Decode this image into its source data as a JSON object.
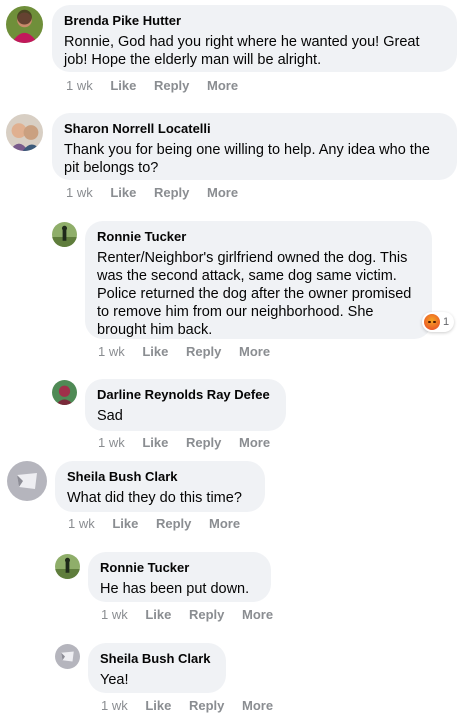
{
  "colors": {
    "bubble": "#f0f2f5",
    "name": "#050505",
    "meta": "#8a8d91"
  },
  "comments": [
    {
      "author": "Brenda Pike Hutter",
      "text": "Ronnie, God had you right where he wanted you! Great job! Hope the elderly man will be alright.",
      "time": "1 wk",
      "like": "Like",
      "reply": "Reply",
      "more": "More",
      "avatar_icon": "profile-photo"
    },
    {
      "author": "Sharon Norrell Locatelli",
      "text": "Thank you for being one willing to help. Any idea who the pit belongs to?",
      "time": "1 wk",
      "like": "Like",
      "reply": "Reply",
      "more": "More",
      "avatar_icon": "profile-photo"
    },
    {
      "author": "Ronnie Tucker",
      "text": "Renter/Neighbor's girlfriend owned the dog. This was the second attack, same dog same victim. Police returned the dog after the owner promised to remove him from our neighborhood. She brought him back.",
      "time": "1 wk",
      "like": "Like",
      "reply": "Reply",
      "more": "More",
      "avatar_icon": "profile-photo",
      "reaction": {
        "icon": "angry-reaction-icon",
        "count": "1"
      }
    },
    {
      "author": "Darline Reynolds Ray Defee",
      "text": "Sad",
      "time": "1 wk",
      "like": "Like",
      "reply": "Reply",
      "more": "More",
      "avatar_icon": "profile-photo"
    },
    {
      "author": "Sheila Bush Clark",
      "text": "What did they do this time?",
      "time": "1 wk",
      "like": "Like",
      "reply": "Reply",
      "more": "More",
      "avatar_icon": "profile-photo"
    },
    {
      "author": "Ronnie Tucker",
      "text": "He has been put down.",
      "time": "1 wk",
      "like": "Like",
      "reply": "Reply",
      "more": "More",
      "avatar_icon": "profile-photo"
    },
    {
      "author": "Sheila Bush Clark",
      "text": "Yea!",
      "time": "1 wk",
      "like": "Like",
      "reply": "Reply",
      "more": "More",
      "avatar_icon": "profile-photo"
    }
  ]
}
